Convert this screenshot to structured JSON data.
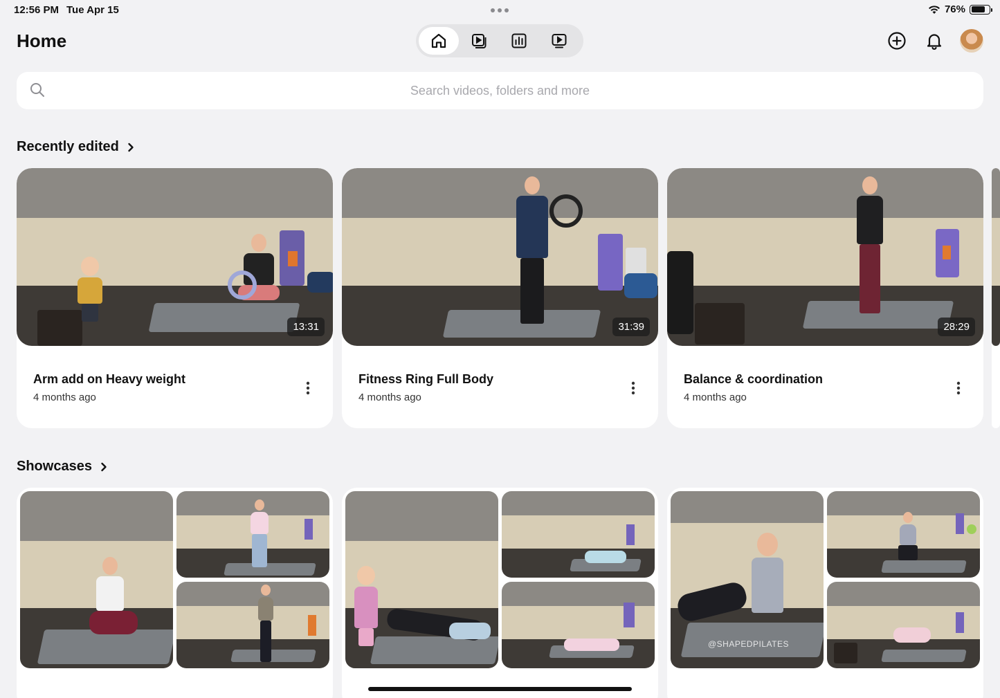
{
  "status_bar": {
    "time": "12:56 PM",
    "date": "Tue Apr 15",
    "battery": "76%",
    "battery_level": 0.76
  },
  "header": {
    "title": "Home",
    "nav_tabs": [
      {
        "name": "home",
        "icon": "home-icon",
        "active": true
      },
      {
        "name": "videos",
        "icon": "video-library-icon",
        "active": false
      },
      {
        "name": "analytics",
        "icon": "bar-chart-icon",
        "active": false
      },
      {
        "name": "showcases",
        "icon": "play-window-icon",
        "active": false
      }
    ],
    "actions": [
      "add-circle-icon",
      "bell-icon",
      "avatar"
    ]
  },
  "search": {
    "placeholder": "Search videos, folders and more",
    "value": ""
  },
  "recently_edited": {
    "title": "Recently edited",
    "items": [
      {
        "title": "Arm add on Heavy weight",
        "subtitle": "4 months ago",
        "duration": "13:31"
      },
      {
        "title": "Fitness Ring Full Body",
        "subtitle": "4 months ago",
        "duration": "31:39"
      },
      {
        "title": "Balance & coordination",
        "subtitle": "4 months ago",
        "duration": "28:29"
      }
    ]
  },
  "showcases": {
    "title": "Showcases",
    "watermark": "@SHAPEDPILATES"
  },
  "colors": {
    "background": "#f2f2f4",
    "card": "#ffffff",
    "wall": "#d7cdb5",
    "wall_top": "#8c8984",
    "floor": "#3e3a36"
  }
}
